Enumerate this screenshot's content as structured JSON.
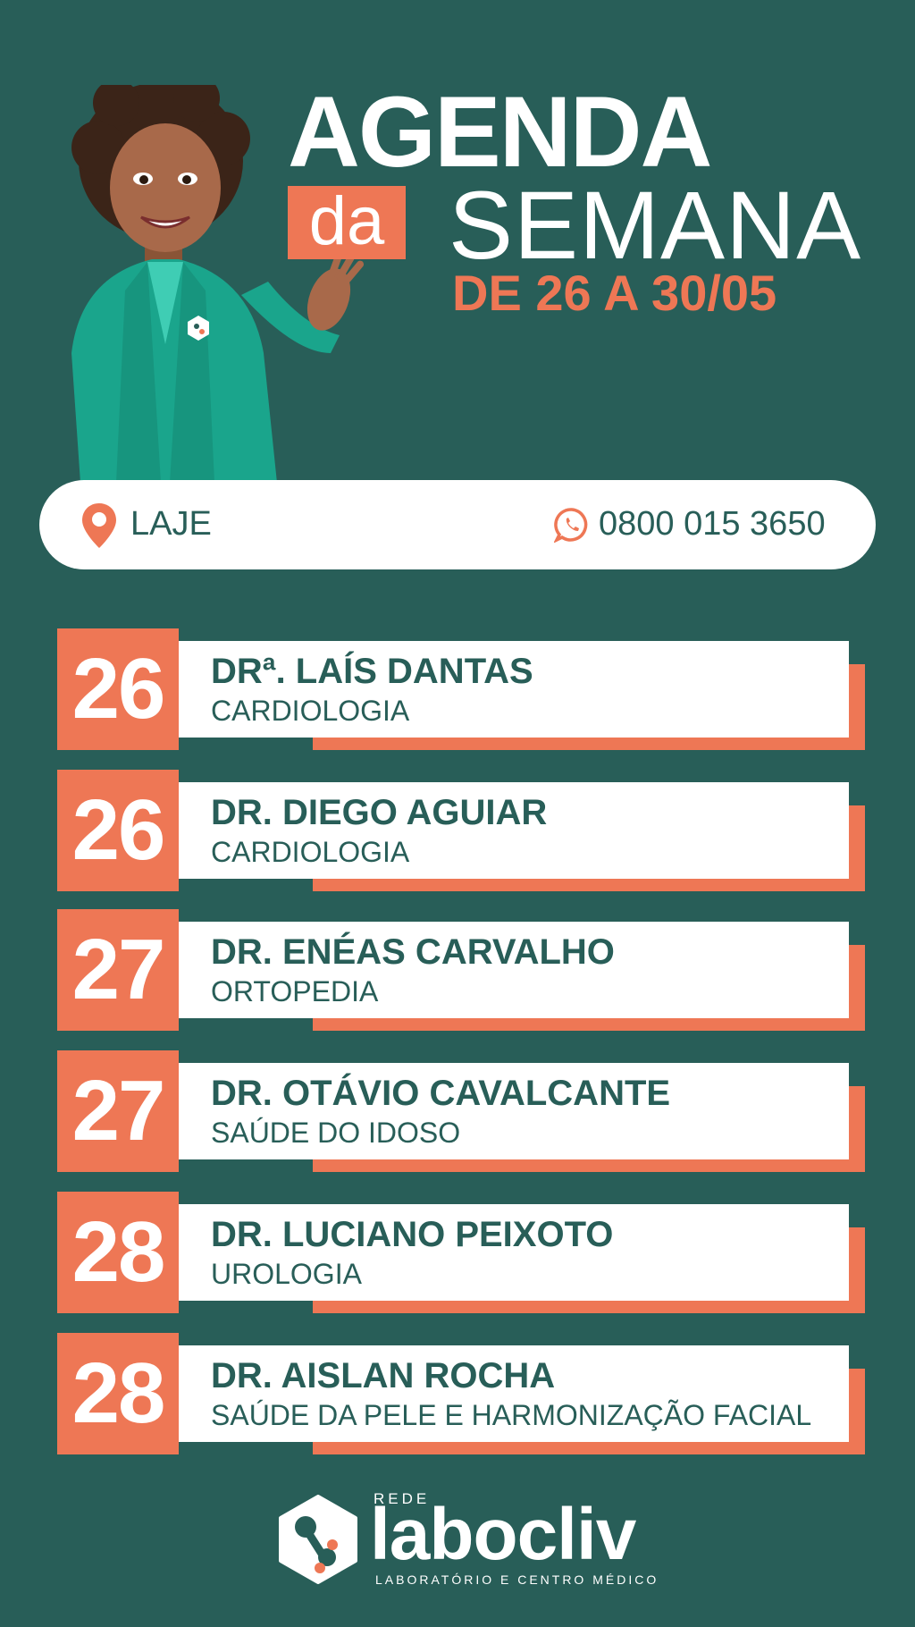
{
  "header": {
    "title_line1": "AGENDA",
    "title_da": "da",
    "title_semana": "SEMANA",
    "date_range": "DE 26 A 30/05"
  },
  "mascot": {
    "icon": "waving-doctor-mascot"
  },
  "info_bar": {
    "location_icon": "map-pin-icon",
    "location": "LAJE",
    "phone_icon": "whatsapp-icon",
    "phone": "0800 015 3650"
  },
  "schedule": [
    {
      "day": "26",
      "doctor": "DRª. LAÍS DANTAS",
      "specialty": "CARDIOLOGIA"
    },
    {
      "day": "26",
      "doctor": "DR. DIEGO AGUIAR",
      "specialty": "CARDIOLOGIA"
    },
    {
      "day": "27",
      "doctor": "DR. ENÉAS CARVALHO",
      "specialty": "ORTOPEDIA"
    },
    {
      "day": "27",
      "doctor": "DR. OTÁVIO CAVALCANTE",
      "specialty": "SAÚDE DO IDOSO"
    },
    {
      "day": "28",
      "doctor": "DR. LUCIANO PEIXOTO",
      "specialty": "UROLOGIA"
    },
    {
      "day": "28",
      "doctor": "DR. AISLAN ROCHA",
      "specialty": "SAÚDE DA PELE E HARMONIZAÇÃO FACIAL"
    }
  ],
  "logo": {
    "icon": "laboccliv-hexagon-logo",
    "rede": "REDE",
    "name": "labocliv",
    "tagline": "LABORATÓRIO E CENTRO MÉDICO"
  },
  "colors": {
    "background": "#285e58",
    "accent": "#ee7755",
    "card": "#ffffff",
    "text_dark": "#285e58"
  }
}
